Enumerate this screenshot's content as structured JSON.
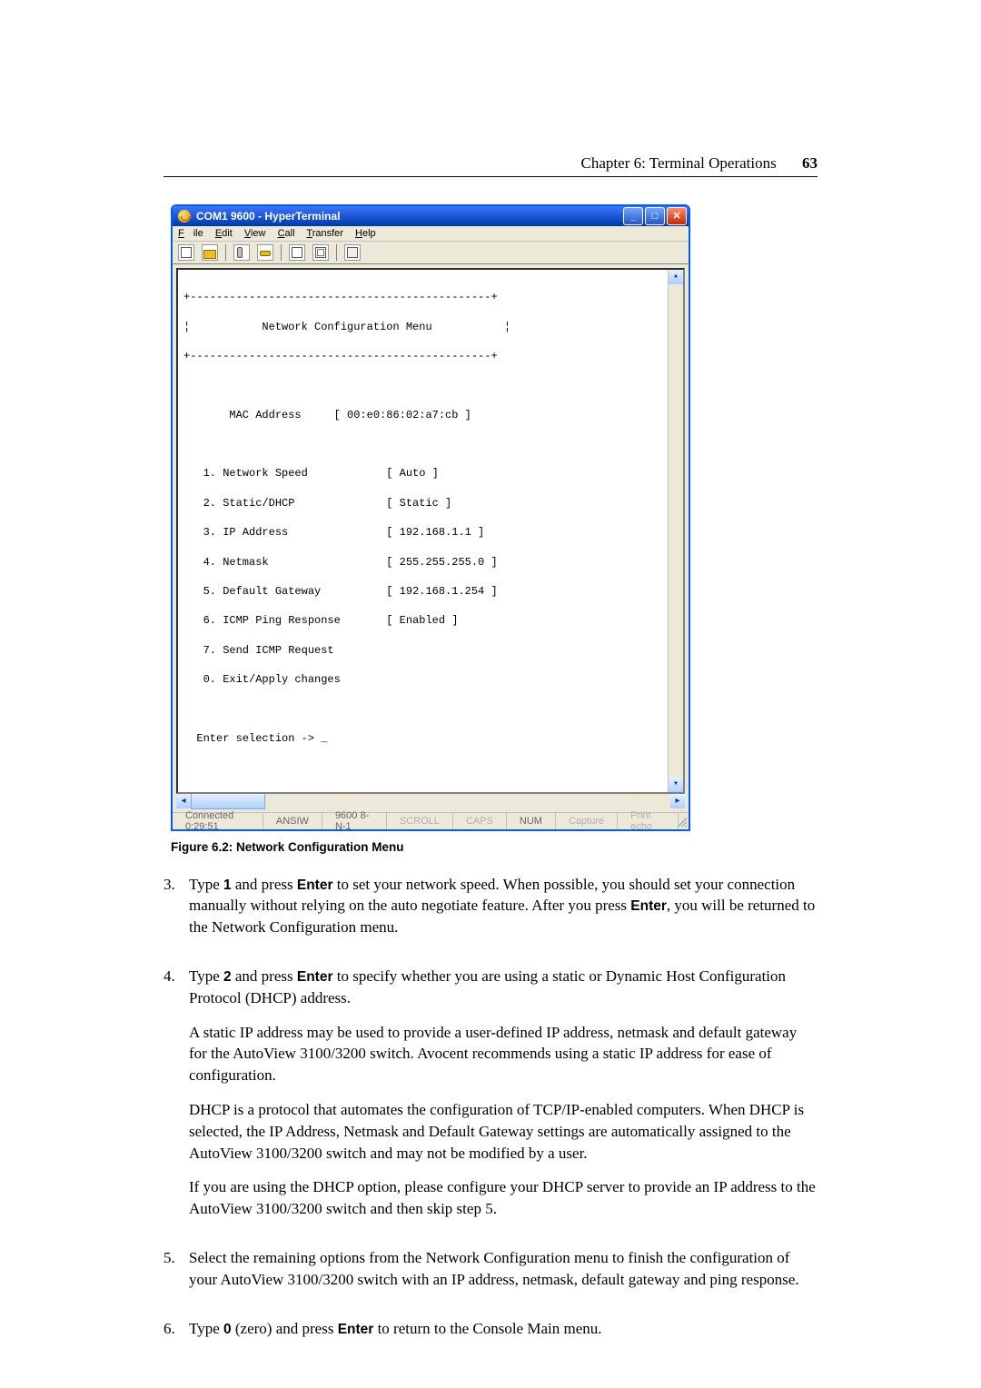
{
  "header": {
    "chapter": "Chapter 6: Terminal Operations",
    "page": "63"
  },
  "window": {
    "title": "COM1 9600 - HyperTerminal",
    "menus": {
      "file": "File",
      "edit": "Edit",
      "view": "View",
      "call": "Call",
      "transfer": "Transfer",
      "help": "Help"
    },
    "terminal": {
      "top_border": "+----------------------------------------------+",
      "title_row": "¦           Network Configuration Menu           ¦",
      "mid_border": "+----------------------------------------------+",
      "mac": "       MAC Address     [ 00:e0:86:02:a7:cb ]",
      "l1": "   1. Network Speed            [ Auto ]",
      "l2": "   2. Static/DHCP              [ Static ]",
      "l3": "   3. IP Address               [ 192.168.1.1 ]",
      "l4": "   4. Netmask                  [ 255.255.255.0 ]",
      "l5": "   5. Default Gateway          [ 192.168.1.254 ]",
      "l6": "   6. ICMP Ping Response       [ Enabled ]",
      "l7": "   7. Send ICMP Request",
      "l8": "   0. Exit/Apply changes",
      "prompt": "  Enter selection -> _"
    },
    "status": {
      "connected": "Connected 0:29:51",
      "emul": "ANSIW",
      "port": "9600 8-N-1",
      "scroll": "SCROLL",
      "caps": "CAPS",
      "num": "NUM",
      "capture": "Capture",
      "echo": "Print echo"
    }
  },
  "figure_caption": "Figure 6.2: Network Configuration Menu",
  "steps": {
    "s3": {
      "num": "3.",
      "p1a": "Type ",
      "b1": "1",
      "p1b": " and press ",
      "b2": "Enter",
      "p1c": " to set your network speed. When possible, you should set your connection manually without relying on the auto negotiate feature. After you press ",
      "b3": "Enter",
      "p1d": ", you will be returned to the Network Configuration menu."
    },
    "s4": {
      "num": "4.",
      "p1a": "Type ",
      "b1": "2",
      "p1b": " and press ",
      "b2": "Enter",
      "p1c": " to specify whether you are using a static or Dynamic Host Configuration Protocol (DHCP) address.",
      "p2": "A static IP address may be used to provide a user-defined IP address, netmask and default gateway for the AutoView 3100/3200 switch. Avocent recommends using a static IP address for ease of configuration.",
      "p3": "DHCP is a protocol that automates the configuration of TCP/IP-enabled computers. When DHCP is selected, the IP Address, Netmask and Default Gateway settings are automatically assigned to the AutoView 3100/3200 switch and may not be modified by a user.",
      "p4": "If you are using the DHCP option, please configure your DHCP server to provide an IP address to the AutoView 3100/3200 switch and then skip step 5."
    },
    "s5": {
      "num": "5.",
      "p1": "Select the remaining options from the Network Configuration menu to finish the configuration of your AutoView 3100/3200 switch with an IP address, netmask, default gateway and ping response."
    },
    "s6": {
      "num": "6.",
      "p1a": "Type ",
      "b1": "0",
      "p1b": " (zero) and press ",
      "b2": "Enter",
      "p1c": " to return to the Console Main menu."
    }
  }
}
